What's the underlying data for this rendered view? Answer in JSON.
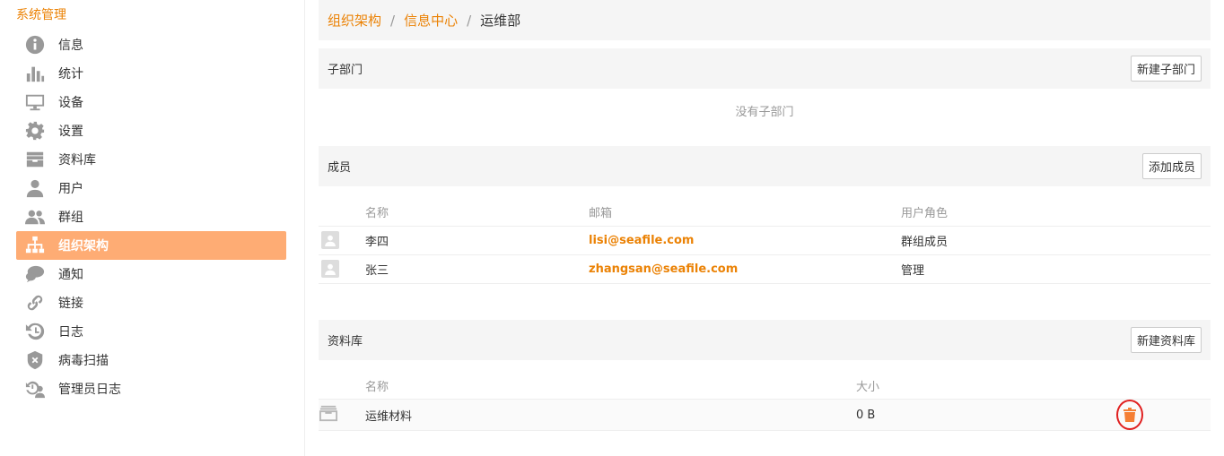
{
  "sidebar": {
    "title": "系统管理",
    "items": [
      {
        "label": "信息",
        "icon": "info-icon"
      },
      {
        "label": "统计",
        "icon": "bar-chart-icon"
      },
      {
        "label": "设备",
        "icon": "monitor-icon"
      },
      {
        "label": "设置",
        "icon": "gear-icon"
      },
      {
        "label": "资料库",
        "icon": "library-icon"
      },
      {
        "label": "用户",
        "icon": "user-icon"
      },
      {
        "label": "群组",
        "icon": "group-icon"
      },
      {
        "label": "组织架构",
        "icon": "org-chart-icon",
        "active": true
      },
      {
        "label": "通知",
        "icon": "chat-icon"
      },
      {
        "label": "链接",
        "icon": "link-icon"
      },
      {
        "label": "日志",
        "icon": "history-icon"
      },
      {
        "label": "病毒扫描",
        "icon": "shield-icon"
      },
      {
        "label": "管理员日志",
        "icon": "admin-log-icon"
      }
    ]
  },
  "breadcrumb": {
    "root": "组织架构",
    "parent": "信息中心",
    "current": "运维部",
    "sep": "/"
  },
  "subdepts": {
    "title": "子部门",
    "button": "新建子部门",
    "empty": "没有子部门"
  },
  "members": {
    "title": "成员",
    "button": "添加成员",
    "columns": [
      "名称",
      "邮箱",
      "用户角色"
    ],
    "rows": [
      {
        "name": "李四",
        "email": "lisi@seafile.com",
        "role": "群组成员"
      },
      {
        "name": "张三",
        "email": "zhangsan@seafile.com",
        "role": "管理"
      }
    ]
  },
  "libraries": {
    "title": "资料库",
    "button": "新建资料库",
    "columns": [
      "名称",
      "大小"
    ],
    "rows": [
      {
        "name": "运维材料",
        "size": "0 B"
      }
    ]
  },
  "colors": {
    "accent": "#eb8205",
    "active_bg": "#feac74",
    "highlight": "#e02020"
  }
}
